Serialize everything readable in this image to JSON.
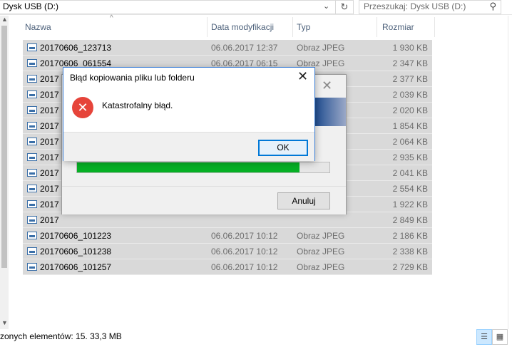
{
  "address": {
    "path": "Dysk USB (D:)",
    "chevron_icon": "chevron-down-icon"
  },
  "search": {
    "placeholder": "Przeszukaj: Dysk USB (D:)"
  },
  "columns": {
    "name": "Nazwa",
    "date": "Data modyfikacji",
    "type": "Typ",
    "size": "Rozmiar"
  },
  "files": [
    {
      "name": "20170606_123713",
      "date": "06.06.2017 12:37",
      "type": "Obraz JPEG",
      "size": "1 930 KB"
    },
    {
      "name": "20170606_061554",
      "date": "06.06.2017 06:15",
      "type": "Obraz JPEG",
      "size": "2 347 KB"
    },
    {
      "name": "2017",
      "date": "",
      "type": "",
      "size": "2 377 KB"
    },
    {
      "name": "2017",
      "date": "",
      "type": "",
      "size": "2 039 KB"
    },
    {
      "name": "2017",
      "date": "",
      "type": "",
      "size": "2 020 KB"
    },
    {
      "name": "2017",
      "date": "",
      "type": "",
      "size": "1 854 KB"
    },
    {
      "name": "2017",
      "date": "",
      "type": "",
      "size": "2 064 KB"
    },
    {
      "name": "2017",
      "date": "",
      "type": "",
      "size": "2 935 KB"
    },
    {
      "name": "2017",
      "date": "",
      "type": "",
      "size": "2 041 KB"
    },
    {
      "name": "2017",
      "date": "",
      "type": "",
      "size": "2 554 KB"
    },
    {
      "name": "2017",
      "date": "",
      "type": "",
      "size": "1 922 KB"
    },
    {
      "name": "2017",
      "date": "",
      "type": "",
      "size": "2 849 KB"
    },
    {
      "name": "20170606_101223",
      "date": "06.06.2017 10:12",
      "type": "Obraz JPEG",
      "size": "2 186 KB"
    },
    {
      "name": "20170606_101238",
      "date": "06.06.2017 10:12",
      "type": "Obraz JPEG",
      "size": "2 338 KB"
    },
    {
      "name": "20170606_101257",
      "date": "06.06.2017 10:12",
      "type": "Obraz JPEG",
      "size": "2 729 KB"
    }
  ],
  "status": {
    "text": "zonych elementów: 15. 33,3 MB"
  },
  "progress_dialog": {
    "cancel_label": "Anuluj",
    "progress": 0.88
  },
  "error_dialog": {
    "title": "Błąd kopiowania pliku lub folderu",
    "message": "Katastrofalny błąd.",
    "ok_label": "OK"
  },
  "colors": {
    "accent": "#0078d7",
    "progress": "#06b025",
    "error": "#e6443a",
    "row_selected": "#d9d9d9"
  }
}
